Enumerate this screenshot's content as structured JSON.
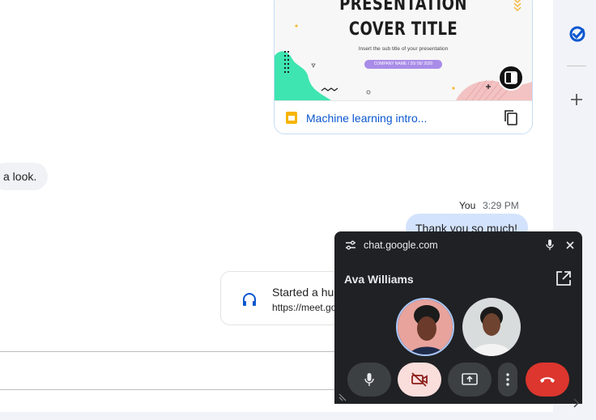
{
  "slide": {
    "title_line1": "PRESENTATION",
    "title_line2": "COVER TITLE",
    "subtitle": "Insert the sub title of your presentation",
    "pill": "COMPANY NAME / 20/ 05/ 2020"
  },
  "attachment": {
    "file_name": "Machine learning intro...",
    "icon": "slides-icon"
  },
  "messages": [
    {
      "text": "a look."
    },
    {
      "sender": "You",
      "time": "3:29 PM",
      "text": "Thank you so much!"
    }
  ],
  "huddle": {
    "title": "Started a hu",
    "link": "https://meet.go"
  },
  "call": {
    "url": "chat.google.com",
    "caller": "Ava Williams",
    "colors": {
      "background": "#202124",
      "end": "#dc362e",
      "camera_off_bg": "#f9dedc"
    }
  },
  "rail": {
    "icons": [
      "tasks-icon",
      "add-icon"
    ],
    "accent": "#0b57d0"
  }
}
